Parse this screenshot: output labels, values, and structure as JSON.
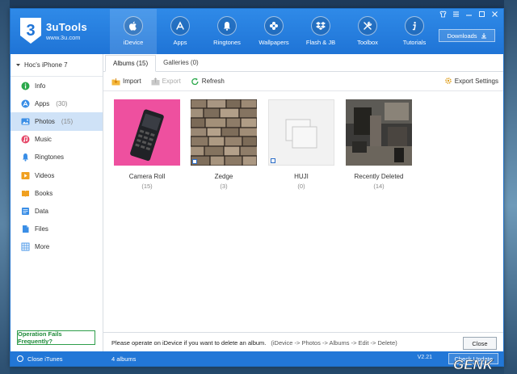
{
  "app": {
    "name": "3uTools",
    "url": "www.3u.com"
  },
  "nav": [
    {
      "label": "iDevice",
      "icon": "apple-icon"
    },
    {
      "label": "Apps",
      "icon": "appstore-icon"
    },
    {
      "label": "Ringtones",
      "icon": "bell-icon"
    },
    {
      "label": "Wallpapers",
      "icon": "flower-icon"
    },
    {
      "label": "Flash & JB",
      "icon": "dropbox-icon"
    },
    {
      "label": "Toolbox",
      "icon": "tools-icon"
    },
    {
      "label": "Tutorials",
      "icon": "info-icon"
    }
  ],
  "header": {
    "downloads_label": "Downloads"
  },
  "sidebar": {
    "device": "Hoc's iPhone 7",
    "items": [
      {
        "label": "Info",
        "count": "",
        "icon": "info-icon",
        "color": "#2aa84a"
      },
      {
        "label": "Apps",
        "count": "(30)",
        "icon": "apps-icon",
        "color": "#3a8ee6"
      },
      {
        "label": "Photos",
        "count": "(15)",
        "icon": "photos-icon",
        "color": "#3a8ee6"
      },
      {
        "label": "Music",
        "count": "",
        "icon": "music-icon",
        "color": "#e64a6a"
      },
      {
        "label": "Ringtones",
        "count": "",
        "icon": "bell-icon",
        "color": "#3a8ee6"
      },
      {
        "label": "Videos",
        "count": "",
        "icon": "video-icon",
        "color": "#f0a020"
      },
      {
        "label": "Books",
        "count": "",
        "icon": "book-icon",
        "color": "#f0a020"
      },
      {
        "label": "Data",
        "count": "",
        "icon": "data-icon",
        "color": "#3a8ee6"
      },
      {
        "label": "Files",
        "count": "",
        "icon": "files-icon",
        "color": "#3a8ee6"
      },
      {
        "label": "More",
        "count": "",
        "icon": "grid-icon",
        "color": "#3a8ee6"
      }
    ],
    "help_label": "Operation Fails Frequently?"
  },
  "tabs": [
    {
      "label": "Albums (15)"
    },
    {
      "label": "Galleries (0)"
    }
  ],
  "toolbar": {
    "import_label": "Import",
    "export_label": "Export",
    "refresh_label": "Refresh",
    "export_settings_label": "Export Settings"
  },
  "albums": [
    {
      "title": "Camera Roll",
      "count": "(15)"
    },
    {
      "title": "Zedge",
      "count": "(3)"
    },
    {
      "title": "HUJI",
      "count": "(0)"
    },
    {
      "title": "Recently Deleted",
      "count": "(14)"
    }
  ],
  "footer": {
    "message": "Please operate on iDevice if you want to delete an album.",
    "hint": "(iDevice -> Photos -> Albums -> Edit -> Delete)",
    "close_label": "Close"
  },
  "status": {
    "close_itunes": "Close iTunes",
    "albums_count": "4 albums",
    "version": "V2.21",
    "check_update": "Check Update"
  },
  "watermark": "GENK",
  "colors": {
    "accent": "#1f74d6",
    "active_bg": "#cfe2f7",
    "help_green": "#1f8a3a"
  }
}
